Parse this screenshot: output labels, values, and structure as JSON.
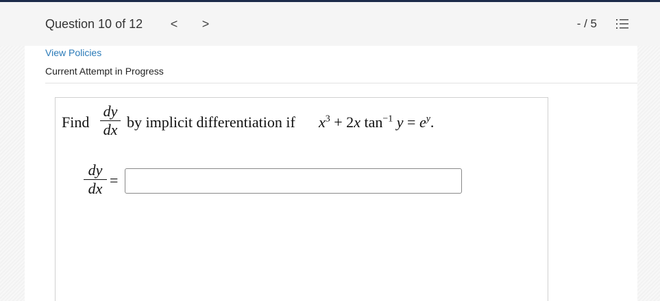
{
  "header": {
    "question_label": "Question 10 of 12",
    "prev_glyph": "<",
    "next_glyph": ">",
    "score": "- / 5",
    "list_icon": "list-icon"
  },
  "links": {
    "view_policies": "View Policies"
  },
  "status": {
    "attempt": "Current Attempt in Progress"
  },
  "question": {
    "find_word": "Find",
    "dy": "dy",
    "dx": "dx",
    "middle_text": "by implicit differentiation if",
    "x": "x",
    "x_exp": "3",
    "plus_2x": "+ 2",
    "x2": "x",
    "tan": "tan",
    "tan_exp": "−1",
    "y": "y",
    "equals_e": "=",
    "e": "e",
    "e_exp": "y",
    "period": "."
  },
  "answer": {
    "dy": "dy",
    "dx": "dx",
    "equals": "=",
    "value": "",
    "placeholder": ""
  }
}
